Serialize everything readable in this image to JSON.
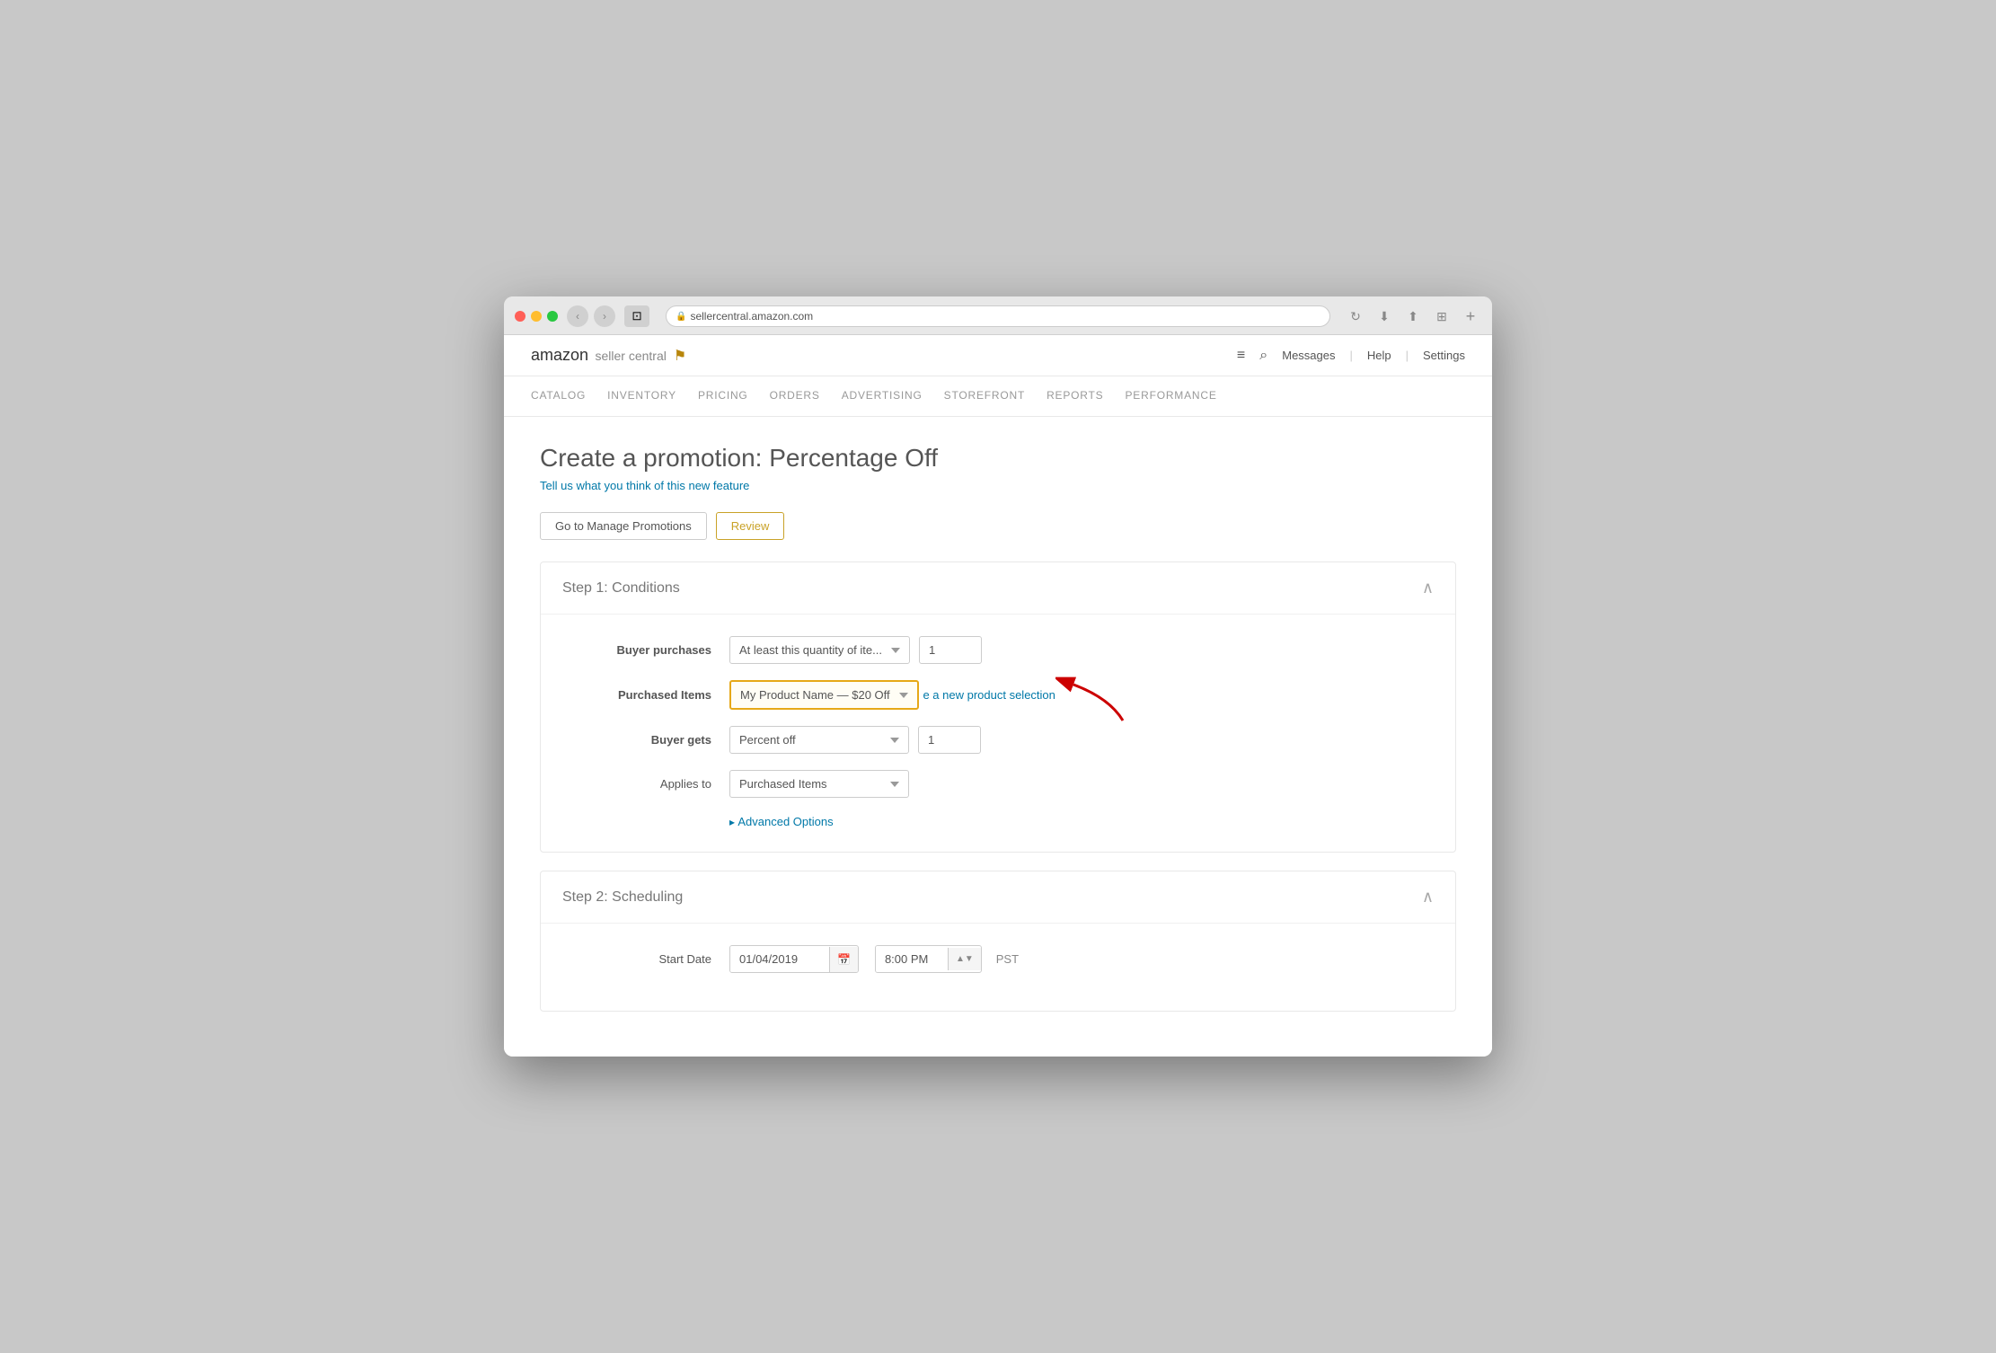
{
  "browser": {
    "url": "sellercentral.amazon.com",
    "tab_icon": "□"
  },
  "header": {
    "logo_amazon": "amazon",
    "logo_seller": "seller central",
    "nav_items": [
      "Messages",
      "Help",
      "Settings"
    ]
  },
  "main_nav": {
    "items": [
      {
        "label": "CATALOG",
        "id": "catalog"
      },
      {
        "label": "INVENTORY",
        "id": "inventory"
      },
      {
        "label": "PRICING",
        "id": "pricing"
      },
      {
        "label": "ORDERS",
        "id": "orders"
      },
      {
        "label": "ADVERTISING",
        "id": "advertising"
      },
      {
        "label": "STOREFRONT",
        "id": "storefront"
      },
      {
        "label": "REPORTS",
        "id": "reports"
      },
      {
        "label": "PERFORMANCE",
        "id": "performance"
      }
    ]
  },
  "page": {
    "title": "Create a promotion: Percentage Off",
    "subtitle_link": "Tell us what you think of this new feature",
    "btn_manage": "Go to Manage Promotions",
    "btn_review": "Review"
  },
  "step1": {
    "title": "Step 1: Conditions",
    "fields": {
      "buyer_purchases_label": "Buyer purchases",
      "buyer_purchases_value": "At least this quantity of ite...",
      "buyer_purchases_qty": "1",
      "purchased_items_label": "Purchased Items",
      "purchased_items_value": "My Product Name — $20 Off",
      "create_new_link": "e a new product selection",
      "buyer_gets_label": "Buyer gets",
      "buyer_gets_value": "Percent off",
      "buyer_gets_qty": "1",
      "applies_to_label": "Applies to",
      "applies_to_value": "Purchased Items",
      "advanced_options": "Advanced Options"
    }
  },
  "step2": {
    "title": "Step 2: Scheduling",
    "fields": {
      "start_date_label": "Start Date",
      "start_date_value": "01/04/2019",
      "start_time_value": "8:00 PM",
      "timezone_value": "PST"
    }
  }
}
